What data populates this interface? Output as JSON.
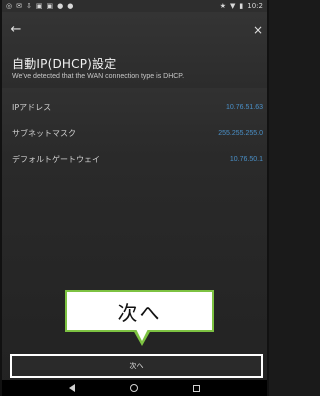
{
  "status_bar": {
    "left_icons": [
      "notification-icon",
      "mail-icon",
      "download-icon",
      "image-icon",
      "image-icon",
      "app-icon",
      "app-icon"
    ],
    "right_icons": [
      "star-icon",
      "wifi-icon",
      "battery-icon"
    ],
    "time": "10:2"
  },
  "header": {
    "back_glyph": "←",
    "close_glyph": "×",
    "title": "自動IP(DHCP)設定",
    "subtitle": "We've detected that the WAN connection type is DHCP."
  },
  "rows": [
    {
      "label": "IPアドレス",
      "value": "10.76.51.63"
    },
    {
      "label": "サブネットマスク",
      "value": "255.255.255.0"
    },
    {
      "label": "デフォルトゲートウェイ",
      "value": "10.76.50.1"
    }
  ],
  "callout": {
    "text": "次へ"
  },
  "next_button": {
    "label": "次へ"
  },
  "colors": {
    "accent_value": "#4a90c8",
    "callout_border": "#7dc242",
    "highlight_border": "#ffffff"
  }
}
